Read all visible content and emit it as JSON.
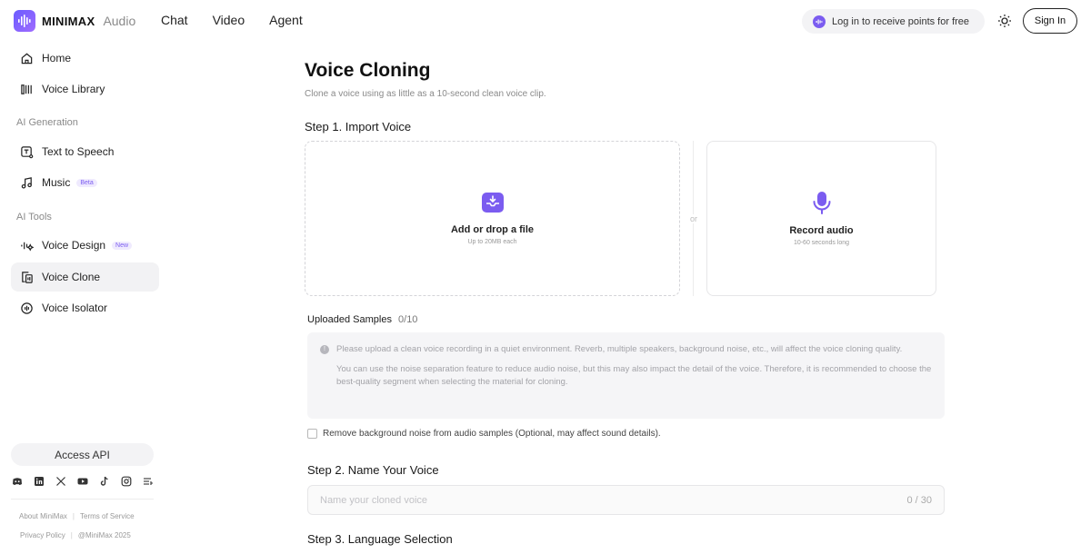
{
  "brand": {
    "name": "MINIMAX",
    "product": "Audio",
    "accent": "#7b5cf0"
  },
  "topnav": {
    "items": [
      "Chat",
      "Video",
      "Agent"
    ]
  },
  "header": {
    "login_prompt": "Log in to receive points for free",
    "sign_in": "Sign In"
  },
  "sidebar": {
    "home": "Home",
    "voice_library": "Voice Library",
    "section_generation": "AI Generation",
    "text_to_speech": "Text to Speech",
    "music": "Music",
    "music_badge": "Beta",
    "section_tools": "AI Tools",
    "voice_design": "Voice Design",
    "voice_design_badge": "New",
    "voice_clone": "Voice Clone",
    "voice_isolator": "Voice Isolator",
    "access_api": "Access API",
    "socials": [
      "discord-icon",
      "linkedin-icon",
      "x-icon",
      "youtube-icon",
      "tiktok-icon",
      "instagram-icon",
      "more-icon"
    ],
    "footer": {
      "about": "About MiniMax",
      "terms": "Terms of Service",
      "privacy": "Privacy Policy",
      "copyright": "@MiniMax 2025"
    }
  },
  "main": {
    "title": "Voice Cloning",
    "subtitle": "Clone a voice using as little as a 10-second clean voice clip.",
    "step1": "Step 1. Import Voice",
    "upload": {
      "title": "Add or drop a file",
      "hint": "Up to 20MB each"
    },
    "or": "or",
    "record": {
      "title": "Record audio",
      "hint": "10-60 seconds long"
    },
    "uploaded_label": "Uploaded Samples",
    "uploaded_count": "0/10",
    "notice_1": "Please upload a clean voice recording in a quiet environment. Reverb, multiple speakers, background noise, etc., will affect the voice cloning quality.",
    "notice_2": "You can use the noise separation feature to reduce audio noise, but this may also impact the detail of the voice. Therefore, it is recommended to choose the best-quality segment when selecting the material for cloning.",
    "remove_noise": "Remove background noise from audio samples (Optional, may affect sound details).",
    "step2": "Step 2. Name Your Voice",
    "name_placeholder": "Name your cloned voice",
    "name_count": "0 / 30",
    "step3": "Step 3. Language Selection"
  }
}
